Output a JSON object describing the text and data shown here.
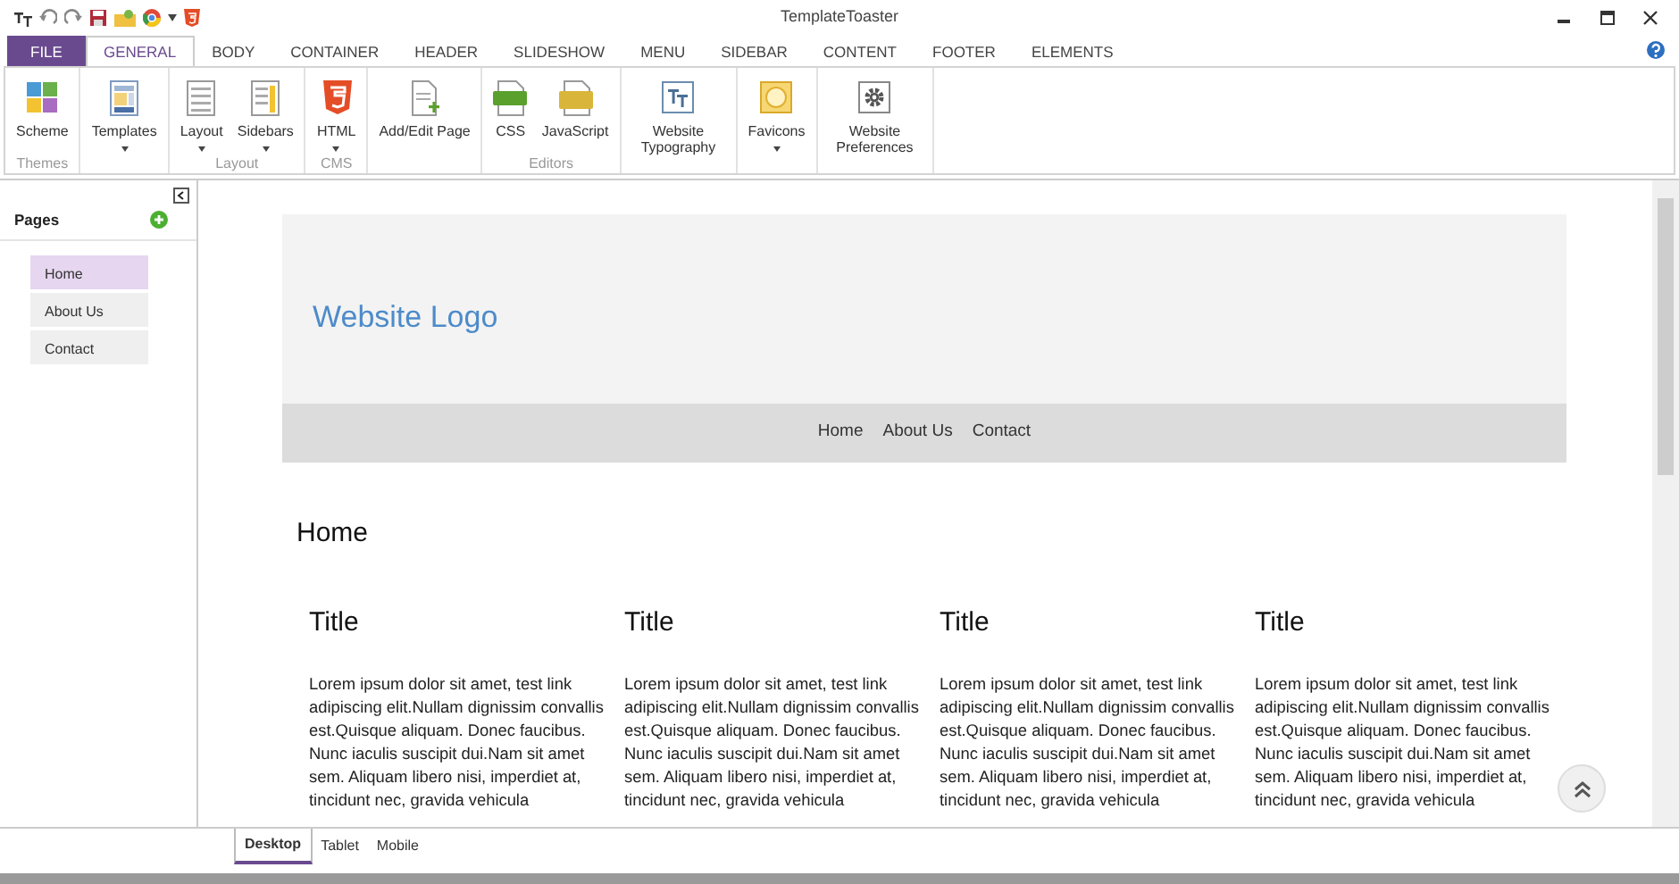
{
  "window": {
    "title": "TemplateToaster"
  },
  "tabs": [
    {
      "label": "FILE",
      "kind": "file",
      "selected": false
    },
    {
      "label": "GENERAL",
      "kind": "tab",
      "selected": true
    },
    {
      "label": "BODY",
      "kind": "tab",
      "selected": false
    },
    {
      "label": "CONTAINER",
      "kind": "tab",
      "selected": false
    },
    {
      "label": "HEADER",
      "kind": "tab",
      "selected": false
    },
    {
      "label": "SLIDESHOW",
      "kind": "tab",
      "selected": false
    },
    {
      "label": "MENU",
      "kind": "tab",
      "selected": false
    },
    {
      "label": "SIDEBAR",
      "kind": "tab",
      "selected": false
    },
    {
      "label": "CONTENT",
      "kind": "tab",
      "selected": false
    },
    {
      "label": "FOOTER",
      "kind": "tab",
      "selected": false
    },
    {
      "label": "ELEMENTS",
      "kind": "tab",
      "selected": false
    }
  ],
  "ribbon": [
    {
      "label": "Themes",
      "buttons": [
        {
          "label": "Scheme",
          "dropdown": false
        }
      ]
    },
    {
      "buttons": [
        {
          "label": "Templates",
          "dropdown": true
        }
      ]
    },
    {
      "label": "Layout",
      "buttons": [
        {
          "label": "Layout",
          "dropdown": true
        },
        {
          "label": "Sidebars",
          "dropdown": true
        }
      ]
    },
    {
      "label": "CMS",
      "buttons": [
        {
          "label": "HTML",
          "dropdown": true
        }
      ]
    },
    {
      "buttons": [
        {
          "label": "Add/Edit Page",
          "dropdown": false
        }
      ]
    },
    {
      "label": "Editors",
      "buttons": [
        {
          "label": "CSS",
          "dropdown": false
        },
        {
          "label": "JavaScript",
          "dropdown": false
        }
      ]
    },
    {
      "buttons": [
        {
          "label": "Website Typography",
          "dropdown": false
        }
      ]
    },
    {
      "buttons": [
        {
          "label": "Favicons",
          "dropdown": true
        }
      ]
    },
    {
      "buttons": [
        {
          "label": "Website Preferences",
          "dropdown": false
        }
      ]
    }
  ],
  "sidebar": {
    "title": "Pages",
    "items": [
      {
        "label": "Home",
        "selected": true
      },
      {
        "label": "About Us",
        "selected": false
      },
      {
        "label": "Contact",
        "selected": false
      }
    ]
  },
  "preview": {
    "logo": "Website Logo",
    "menu": [
      "Home",
      "About Us",
      "Contact"
    ],
    "heading": "Home",
    "columns": [
      {
        "title": "Title",
        "body": "Lorem ipsum dolor sit amet, test link adipiscing elit.Nullam dignissim convallis est.Quisque aliquam. Donec faucibus. Nunc iaculis suscipit dui.Nam sit amet sem. Aliquam libero nisi, imperdiet at, tincidunt nec, gravida vehicula"
      },
      {
        "title": "Title",
        "body": "Lorem ipsum dolor sit amet, test link adipiscing elit.Nullam dignissim convallis est.Quisque aliquam. Donec faucibus. Nunc iaculis suscipit dui.Nam sit amet sem. Aliquam libero nisi, imperdiet at, tincidunt nec, gravida vehicula"
      },
      {
        "title": "Title",
        "body": "Lorem ipsum dolor sit amet, test link adipiscing elit.Nullam dignissim convallis est.Quisque aliquam. Donec faucibus. Nunc iaculis suscipit dui.Nam sit amet sem. Aliquam libero nisi, imperdiet at, tincidunt nec, gravida vehicula"
      },
      {
        "title": "Title",
        "body": "Lorem ipsum dolor sit amet, test link adipiscing elit.Nullam dignissim convallis est.Quisque aliquam. Donec faucibus. Nunc iaculis suscipit dui.Nam sit amet sem. Aliquam libero nisi, imperdiet at, tincidunt nec, gravida vehicula"
      }
    ]
  },
  "view_tabs": [
    {
      "label": "Desktop",
      "selected": true
    },
    {
      "label": "Tablet",
      "selected": false
    },
    {
      "label": "Mobile",
      "selected": false
    }
  ]
}
